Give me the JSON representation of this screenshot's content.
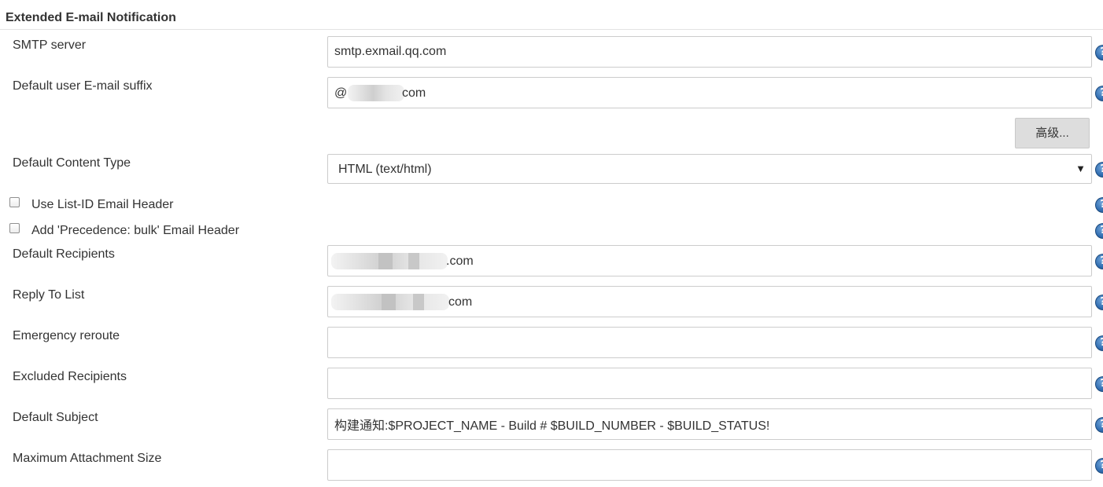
{
  "section": {
    "title": "Extended E-mail Notification"
  },
  "fields": {
    "smtp_server": {
      "label": "SMTP server",
      "value": "smtp.exmail.qq.com"
    },
    "default_suffix": {
      "label": "Default user E-mail suffix",
      "prefix": "@",
      "suffix": "com"
    },
    "advanced_button": "高级...",
    "content_type": {
      "label": "Default Content Type",
      "value": "HTML (text/html)"
    },
    "list_id": {
      "label": "Use List-ID Email Header",
      "checked": false
    },
    "precedence": {
      "label": "Add 'Precedence: bulk' Email Header",
      "checked": false
    },
    "default_recipients": {
      "label": "Default Recipients",
      "suffix": ".com"
    },
    "reply_to": {
      "label": "Reply To List",
      "suffix": "com"
    },
    "emergency_reroute": {
      "label": "Emergency reroute",
      "value": ""
    },
    "excluded_recipients": {
      "label": "Excluded Recipients",
      "value": ""
    },
    "default_subject": {
      "label": "Default Subject",
      "value": "构建通知:$PROJECT_NAME - Build # $BUILD_NUMBER - $BUILD_STATUS!"
    },
    "max_attachment": {
      "label": "Maximum Attachment Size",
      "value": ""
    }
  },
  "help_icon_glyph": "?",
  "select_caret": "▼"
}
